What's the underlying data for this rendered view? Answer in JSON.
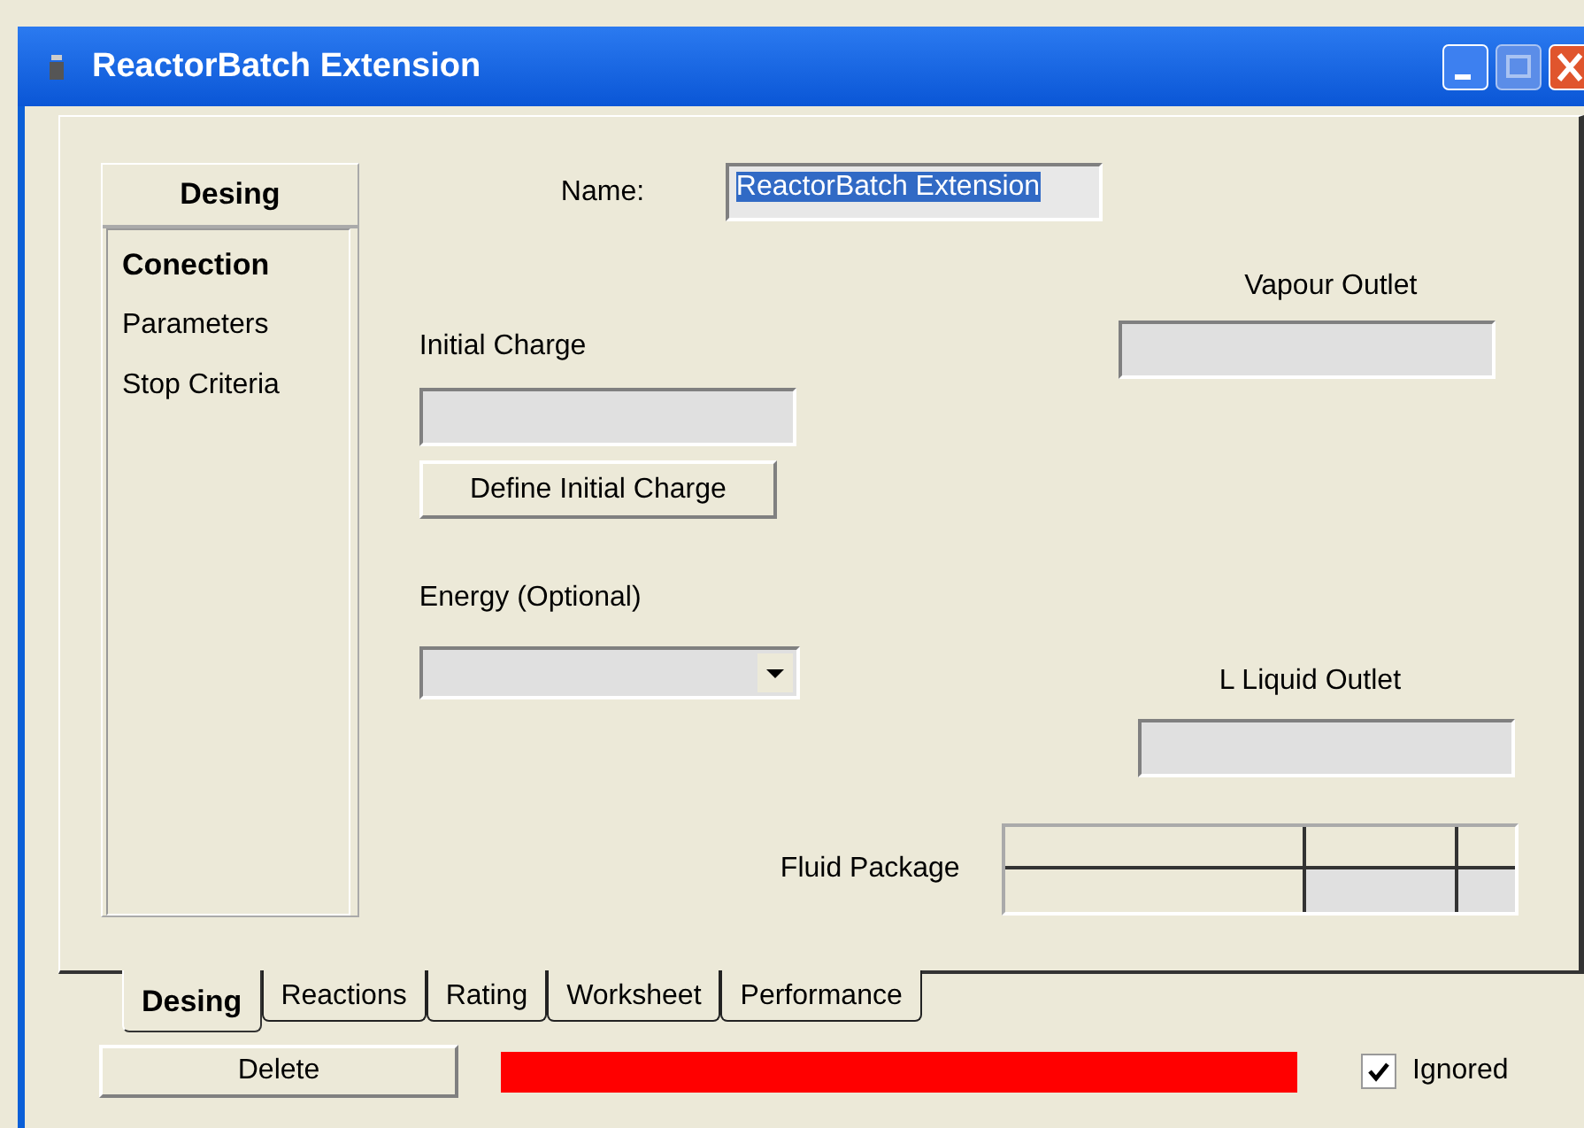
{
  "window": {
    "title": "ReactorBatch Extension"
  },
  "sidebar": {
    "title": "Desing",
    "items": [
      {
        "label": "Conection",
        "selected": true
      },
      {
        "label": "Parameters",
        "selected": false
      },
      {
        "label": "Stop Criteria",
        "selected": false
      }
    ]
  },
  "name_field": {
    "label": "Name:",
    "value": "ReactorBatch Extension"
  },
  "initial_charge": {
    "label": "Initial Charge",
    "button": "Define Initial Charge"
  },
  "energy": {
    "label": "Energy (Optional)"
  },
  "vapour_outlet": {
    "label": "Vapour Outlet"
  },
  "liquid_outlet": {
    "label": "L Liquid Outlet"
  },
  "fluid_package": {
    "label": "Fluid Package"
  },
  "tabs": [
    {
      "label": "Desing",
      "selected": true
    },
    {
      "label": "Reactions",
      "selected": false
    },
    {
      "label": "Rating",
      "selected": false
    },
    {
      "label": "Worksheet",
      "selected": false
    },
    {
      "label": "Performance",
      "selected": false
    }
  ],
  "footer": {
    "delete": "Delete",
    "ignored": {
      "label": "Ignored",
      "checked": true
    }
  }
}
